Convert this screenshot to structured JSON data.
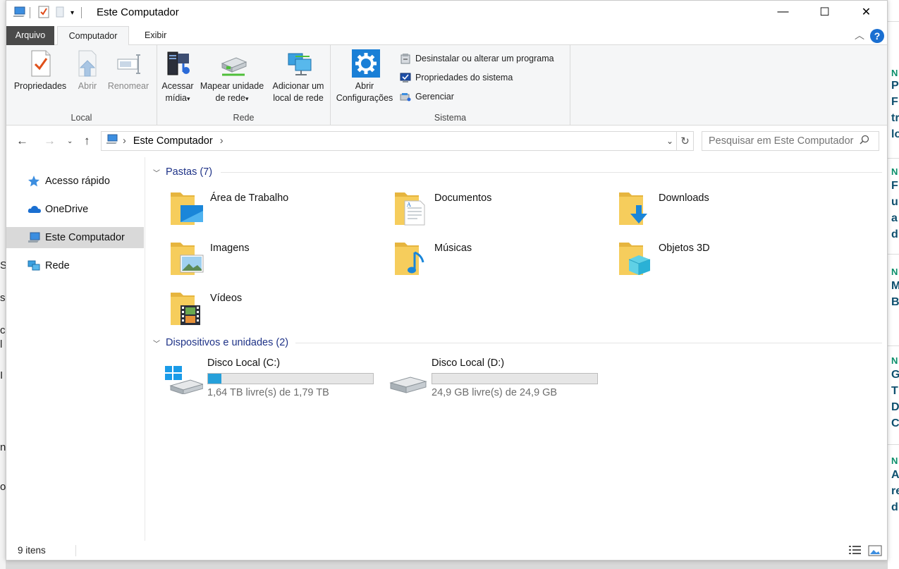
{
  "window": {
    "title": "Este Computador",
    "controls": {
      "minimize": "—",
      "maximize": "☐",
      "close": "✕"
    }
  },
  "ribbon_tabs": {
    "file": "Arquivo",
    "computer": "Computador",
    "view": "Exibir"
  },
  "ribbon": {
    "local": {
      "label": "Local",
      "properties": "Propriedades",
      "open": "Abrir",
      "rename": "Renomear"
    },
    "network": {
      "label": "Rede",
      "media_l1": "Acessar",
      "media_l2": "mídia",
      "map_l1": "Mapear unidade",
      "map_l2": "de rede",
      "add_l1": "Adicionar um",
      "add_l2": "local de rede"
    },
    "system": {
      "label": "Sistema",
      "settings_l1": "Abrir",
      "settings_l2": "Configurações",
      "uninstall": "Desinstalar ou alterar um programa",
      "sysprops": "Propriedades do sistema",
      "manage": "Gerenciar"
    }
  },
  "address": {
    "location": "Este Computador",
    "search_placeholder": "Pesquisar em Este Computador"
  },
  "nav_pane": {
    "items": [
      {
        "label": "Acesso rápido"
      },
      {
        "label": "OneDrive"
      },
      {
        "label": "Este Computador"
      },
      {
        "label": "Rede"
      }
    ]
  },
  "content": {
    "folders_header": "Pastas (7)",
    "folders": [
      {
        "name": "Área de Trabalho"
      },
      {
        "name": "Documentos"
      },
      {
        "name": "Downloads"
      },
      {
        "name": "Imagens"
      },
      {
        "name": "Músicas"
      },
      {
        "name": "Objetos 3D"
      },
      {
        "name": "Vídeos"
      }
    ],
    "devices_header": "Dispositivos e unidades (2)",
    "drives": [
      {
        "name": "Disco Local (C:)",
        "free": "1,64 TB livre(s) de 1,79 TB",
        "used_fraction": 0.08
      },
      {
        "name": "Disco Local (D:)",
        "free": "24,9 GB livre(s) de 24,9 GB",
        "used_fraction": 0.0
      }
    ]
  },
  "status": {
    "count": "9 itens"
  },
  "colors": {
    "accent": "#1a6fd1",
    "drive_fill": "#26a0da",
    "section_header": "#1e3287",
    "folder_yellow": "#f6cd5c"
  }
}
